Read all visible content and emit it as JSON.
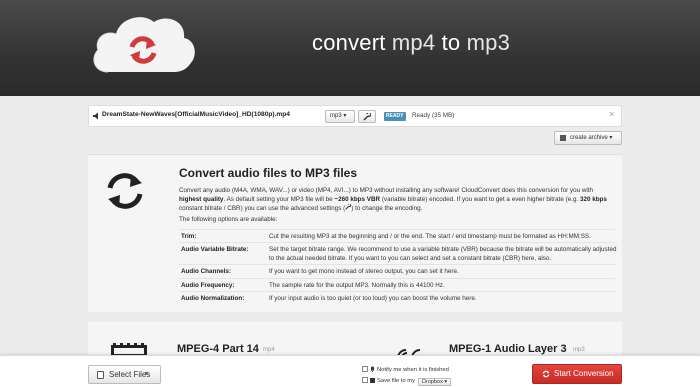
{
  "header": {
    "title_prefix": "convert ",
    "title_from": "mp4",
    "title_mid": " to ",
    "title_to": "mp3",
    "logo_icon": "cloud-refresh-icon",
    "bg_color": "#333333"
  },
  "file": {
    "name": "DreamState-NewWaves[OfficialMusicVideo]_HD(1080p).mp4",
    "format": "mp3",
    "format_caret": "▾",
    "settings_icon": "wrench-icon",
    "status_badge": "READY",
    "status_text": "Ready (35 MB)",
    "close": "×"
  },
  "archive": {
    "label": "create archive ▾"
  },
  "content": {
    "heading": "Convert audio files to MP3 files",
    "desc_1": "Convert any audio (M4A, WMA, WAV...) or video (MP4, AVI...) to MP3 without installing any software! CloudConvert does this conversion for you with ",
    "desc_bold_1": "highest quality",
    "desc_2": ". As default setting your MP3 file will be ",
    "desc_bold_2": "~260 kbps VBR",
    "desc_3": " (variable bitrate) encoded. If you want to get a even higher bitrate (e.g. ",
    "desc_bold_3": "320 kbps",
    "desc_4": " constant bitrate / CBR) you can use the advanced settings (",
    "desc_5": ") to change the encoding.",
    "options_intro": "The following options are available:",
    "options": [
      {
        "key": "Trim:",
        "value": "Cut the resulting MP3 at the beginning and / or the end. The start / end timestamp must be formated as HH:MM:SS."
      },
      {
        "key": "Audio Variable Bitrate:",
        "value": "Set the target bitrate range. We recommend to use a variable bitrate (VBR) because the bitrate will be automatically adjusted to the actual needed bitrate. If you want to you can select and set a constant bitrate (CBR) here, also."
      },
      {
        "key": "Audio Channels:",
        "value": "If you want to get mono instead of stereo output, you can set it here."
      },
      {
        "key": "Audio Frequency:",
        "value": "The sample rate for the output MP3. Normally this is 44100 Hz."
      },
      {
        "key": "Audio Normalization:",
        "value": "If your input audio is too quiet (or too loud) you can boost the volume here."
      }
    ]
  },
  "formats": {
    "from_title": "MPEG-4 Part 14",
    "from_ext": "mp4",
    "to_title": "MPEG-1 Audio Layer 3",
    "to_ext": "mp3"
  },
  "bottom": {
    "select_files": "Select Files",
    "select_caret": "▾",
    "notify_label": "Notify me when it is finished",
    "save_label": "Save file to my",
    "save_target": "Dropbox ▾",
    "start_label": "Start Conversion",
    "start_color": "#d9383a"
  }
}
